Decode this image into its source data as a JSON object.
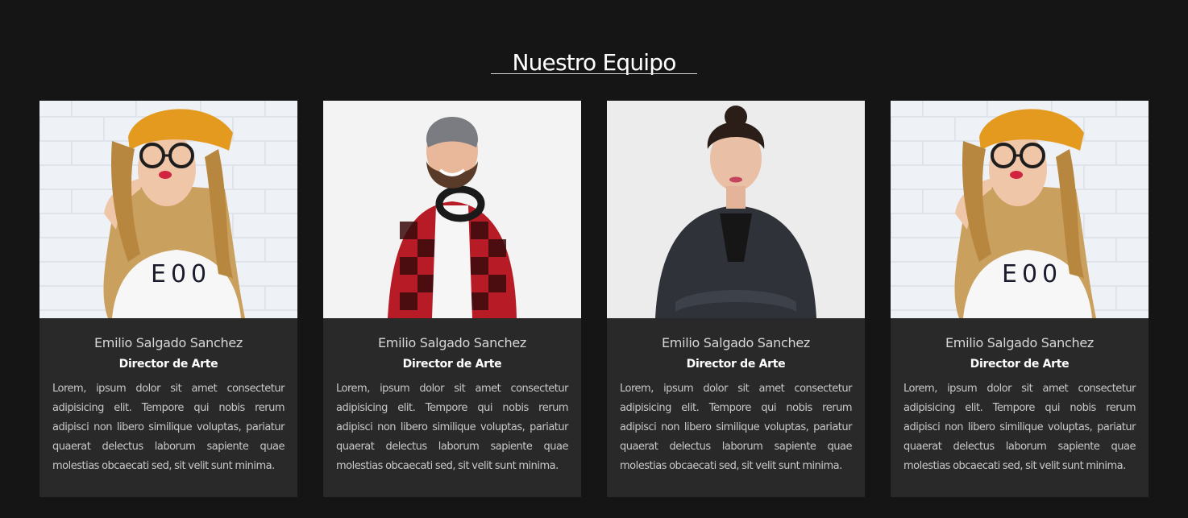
{
  "section": {
    "title": "Nuestro Equipo"
  },
  "team": [
    {
      "photo": "woman-yellow-beanie-glasses",
      "name": "Emilio Salgado Sanchez",
      "role": "Director de Arte",
      "description": "Lorem, ipsum dolor sit amet consectetur adipisicing elit. Tempore qui nobis rerum adipisci non libero similique voluptas, pariatur quaerat delectus laborum sapiente quae molestias obcaecati sed, sit velit sunt minima."
    },
    {
      "photo": "man-beanie-headphones-plaid",
      "name": "Emilio Salgado Sanchez",
      "role": "Director de Arte",
      "description": "Lorem, ipsum dolor sit amet consectetur adipisicing elit. Tempore qui nobis rerum adipisci non libero similique voluptas, pariatur quaerat delectus laborum sapiente quae molestias obcaecati sed, sit velit sunt minima."
    },
    {
      "photo": "woman-blazer-arms-crossed",
      "name": "Emilio Salgado Sanchez",
      "role": "Director de Arte",
      "description": "Lorem, ipsum dolor sit amet consectetur adipisicing elit. Tempore qui nobis rerum adipisci non libero similique voluptas, pariatur quaerat delectus laborum sapiente quae molestias obcaecati sed, sit velit sunt minima."
    },
    {
      "photo": "woman-yellow-beanie-glasses",
      "name": "Emilio Salgado Sanchez",
      "role": "Director de Arte",
      "description": "Lorem, ipsum dolor sit amet consectetur adipisicing elit. Tempore qui nobis rerum adipisci non libero similique voluptas, pariatur quaerat delectus laborum sapiente quae molestias obcaecati sed, sit velit sunt minima."
    }
  ],
  "colors": {
    "page_background": "#151515",
    "card_background": "#292929",
    "title": "#ffffff",
    "name_text": "#d7d7d7",
    "body_text": "#c8c8c8"
  }
}
